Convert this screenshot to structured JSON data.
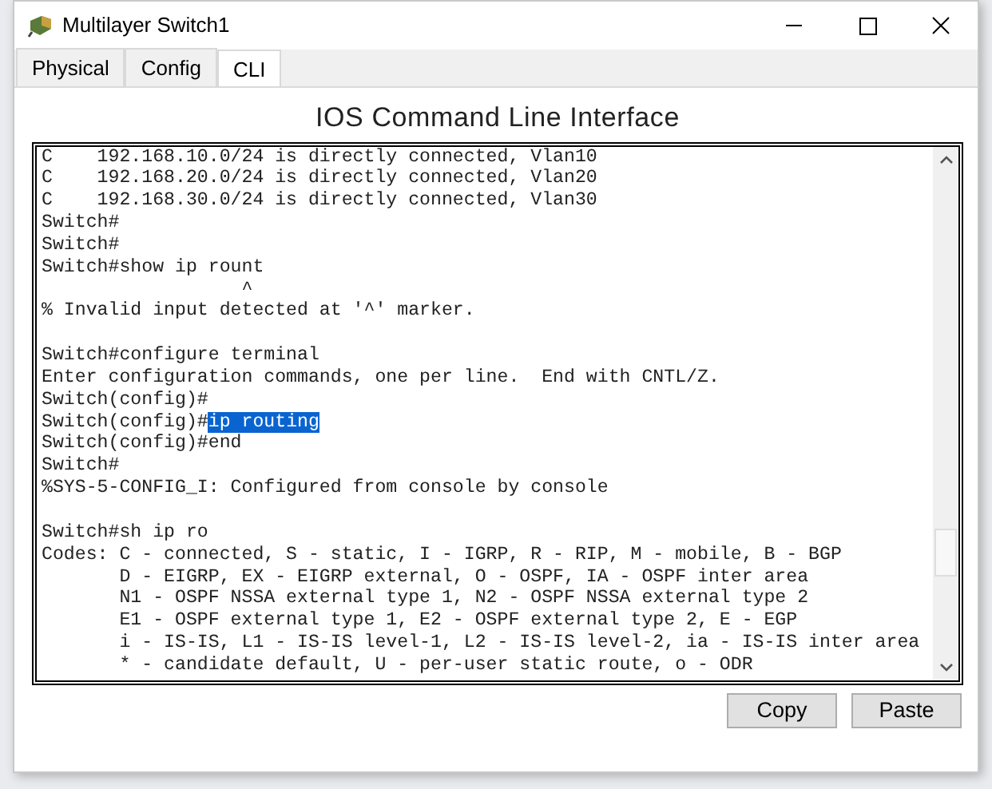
{
  "window": {
    "title": "Multilayer Switch1",
    "controls": [
      {
        "kind": "minimize"
      },
      {
        "kind": "maximize"
      },
      {
        "kind": "close"
      }
    ]
  },
  "tabs": [
    {
      "label": "Physical",
      "selected": false
    },
    {
      "label": "Config",
      "selected": false
    },
    {
      "label": "CLI",
      "selected": true
    }
  ],
  "heading": "IOS Command Line Interface",
  "terminal": {
    "lines": [
      {
        "kind": "text",
        "text": "C    192.168.10.0/24 is directly connected, Vlan10"
      },
      {
        "kind": "text",
        "text": "C    192.168.20.0/24 is directly connected, Vlan20"
      },
      {
        "kind": "text",
        "text": "C    192.168.30.0/24 is directly connected, Vlan30"
      },
      {
        "kind": "text",
        "text": "Switch#"
      },
      {
        "kind": "text",
        "text": "Switch#"
      },
      {
        "kind": "text",
        "text": "Switch#show ip rount"
      },
      {
        "kind": "text",
        "text": "                  ^"
      },
      {
        "kind": "text",
        "text": "% Invalid input detected at '^' marker."
      },
      {
        "kind": "blank"
      },
      {
        "kind": "text",
        "text": "Switch#configure terminal"
      },
      {
        "kind": "text",
        "text": "Enter configuration commands, one per line.  End with CNTL/Z."
      },
      {
        "kind": "text",
        "text": "Switch(config)#"
      },
      {
        "kind": "text",
        "text": "Switch(config)#",
        "selection": "ip routing"
      },
      {
        "kind": "text",
        "text": "Switch(config)#end"
      },
      {
        "kind": "text",
        "text": "Switch#"
      },
      {
        "kind": "text",
        "text": "%SYS-5-CONFIG_I: Configured from console by console"
      },
      {
        "kind": "blank"
      },
      {
        "kind": "text",
        "text": "Switch#sh ip ro"
      },
      {
        "kind": "text",
        "text": "Codes: C - connected, S - static, I - IGRP, R - RIP, M - mobile, B - BGP"
      },
      {
        "kind": "text",
        "text": "       D - EIGRP, EX - EIGRP external, O - OSPF, IA - OSPF inter area"
      },
      {
        "kind": "text",
        "text": "       N1 - OSPF NSSA external type 1, N2 - OSPF NSSA external type 2"
      },
      {
        "kind": "text",
        "text": "       E1 - OSPF external type 1, E2 - OSPF external type 2, E - EGP"
      },
      {
        "kind": "text",
        "text": "       i - IS-IS, L1 - IS-IS level-1, L2 - IS-IS level-2, ia - IS-IS inter area"
      },
      {
        "kind": "text",
        "text": "       * - candidate default, U - per-user static route, o - ODR"
      }
    ]
  },
  "buttons": [
    "Copy",
    "Paste"
  ]
}
